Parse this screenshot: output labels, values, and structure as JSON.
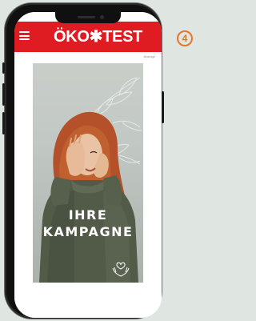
{
  "header": {
    "logo_text": "ÖKO✱TEST"
  },
  "ad": {
    "label": "Anzeige",
    "headline_line1": "IHRE",
    "headline_line2": "KAMPAGNE"
  },
  "badge": {
    "number": "4"
  },
  "colors": {
    "brand_red": "#e01c23",
    "badge_orange": "#e8742a",
    "sweater": "#525a48",
    "hair": "#b4512b"
  },
  "icons": {
    "menu": "hamburger-menu-icon",
    "hands": "hands-heart-icon"
  }
}
